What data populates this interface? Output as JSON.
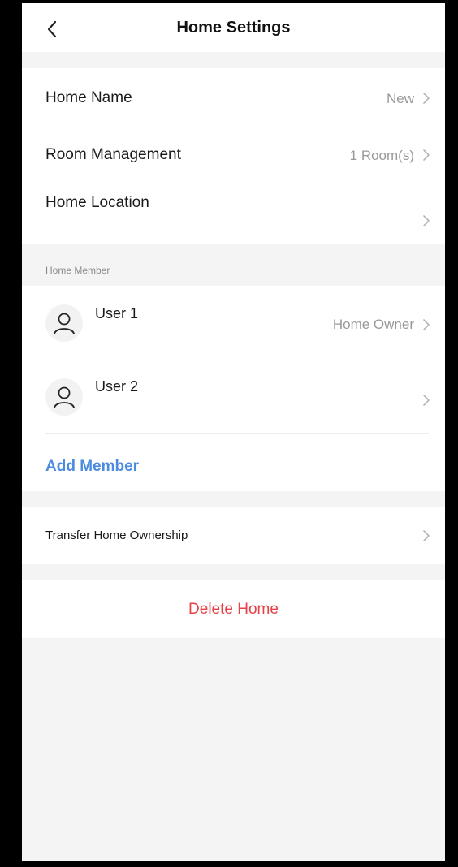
{
  "header": {
    "title": "Home Settings",
    "back_icon": "chevron-left-icon"
  },
  "home": {
    "name_label": "Home Name",
    "name_value": "New",
    "room_label": "Room Management",
    "room_value": "1 Room(s)",
    "location_label": "Home Location",
    "location_value": ""
  },
  "members": {
    "section_label": "Home Member",
    "list": [
      {
        "name": "User 1",
        "role": "Home Owner",
        "avatar_icon": "user-icon"
      },
      {
        "name": "User 2",
        "role": "",
        "avatar_icon": "user-icon"
      }
    ],
    "add_label": "Add Member"
  },
  "transfer": {
    "label": "Transfer Home Ownership"
  },
  "delete": {
    "label": "Delete Home"
  },
  "colors": {
    "accent": "#4b8be0",
    "danger": "#e5424a",
    "background": "#f4f4f4",
    "muted_text": "#999999"
  }
}
